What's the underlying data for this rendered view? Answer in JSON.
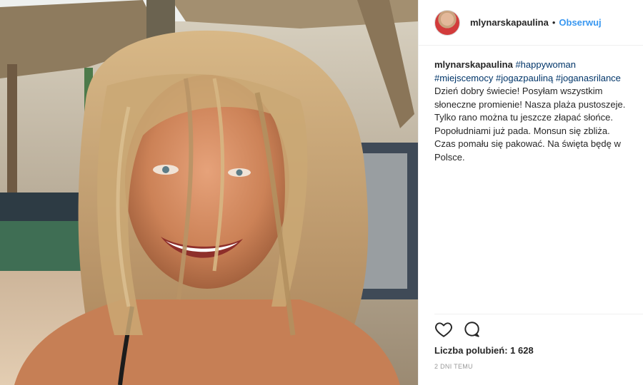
{
  "post": {
    "username": "mlynarskapaulina",
    "separator": "•",
    "follow_label": "Obserwuj",
    "caption": {
      "username": "mlynarskapaulina",
      "hashtags": [
        "#happywoman",
        "#miejscemocy",
        "#jogazpauliną",
        "#joganasrilance"
      ],
      "text": "Dzień dobry świecie! Posyłam wszystkim słoneczne promienie! Nasza plaża pustoszeje. Tylko rano można tu jeszcze złapać słońce. Popołudniami już pada. Monsun się zbliża. Czas pomału się pakować. Na święta będę w Polsce."
    },
    "likes_label": "Liczba polubień: 1 628",
    "timestamp": "2 DNI TEMU"
  },
  "icons": {
    "like": "heart-icon",
    "comment": "speech-bubble-icon"
  },
  "colors": {
    "link": "#3897f0",
    "hashtag": "#003569",
    "text": "#262626",
    "muted": "#999999"
  }
}
